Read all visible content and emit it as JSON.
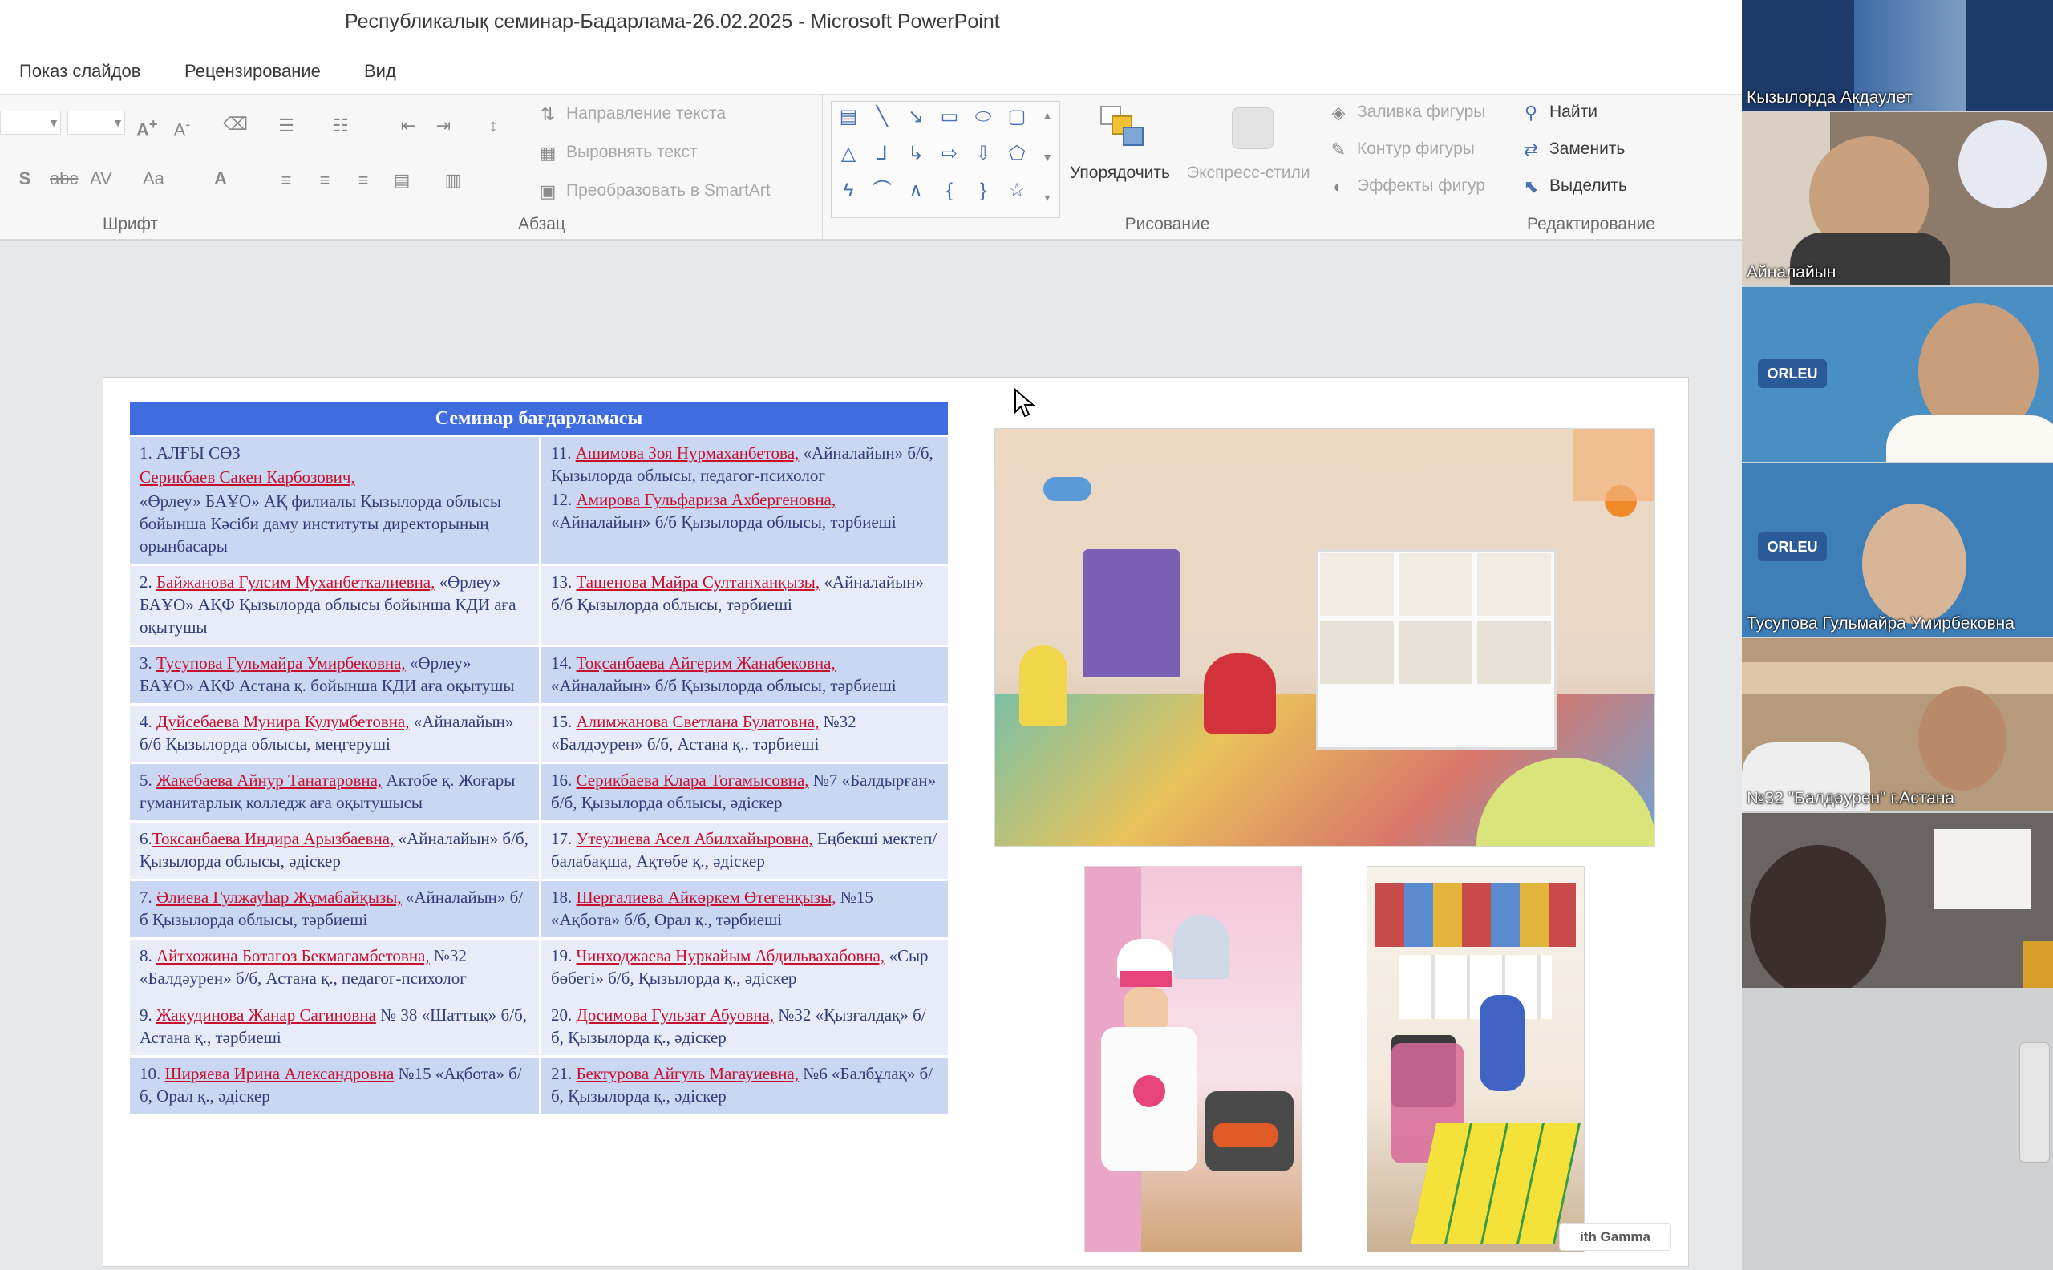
{
  "window": {
    "title": "Республикалық семинар-Бадарлама-26.02.2025  -  Microsoft PowerPoint"
  },
  "menu": [
    "Показ слайдов",
    "Рецензирование",
    "Вид"
  ],
  "ribbon": {
    "groups": {
      "font": "Шрифт",
      "paragraph": "Абзац",
      "drawing": "Рисование",
      "editing": "Редактирование"
    },
    "paragraph": {
      "text_direction": "Направление текста",
      "align_text": "Выровнять текст",
      "smartart": "Преобразовать в SmartArt"
    },
    "drawing": {
      "arrange": "Упорядочить",
      "quick_styles": "Экспресс-стили",
      "shape_fill": "Заливка фигуры",
      "shape_outline": "Контур фигуры",
      "shape_effects": "Эффекты фигур"
    },
    "editing": {
      "find": "Найти",
      "replace": "Заменить",
      "select": "Выделить"
    }
  },
  "slide": {
    "table_title": "Семинар бағдарламасы",
    "badge": "ith Gamma",
    "rows": [
      {
        "shade": "b",
        "left": [
          {
            "pre": "1.  АЛҒЫ СӨЗ",
            "name": "",
            "rest": ""
          },
          {
            "pre": "",
            "name": "Серикбаев Сакен Карбозович,",
            "rest": ""
          },
          {
            "pre": "",
            "name": "",
            "rest": "«Өрлеу» БАҰО» АҚ филиалы Қызылорда облысы бойынша Кәсіби даму институты директорының орынбасары"
          }
        ],
        "right": [
          {
            "pre": "11. ",
            "name": "Ашимова Зоя Нурмаханбетова,",
            "rest": " «Айналайын» б/б, Қызылорда облысы, педагог-психолог"
          },
          {
            "pre": "12. ",
            "name": "Амирова Гульфариза Ахбергеновна,",
            "rest": " «Айналайын» б/б Қызылорда облысы, тәрбиеші"
          }
        ]
      },
      {
        "shade": "w",
        "left": [
          {
            "pre": "2. ",
            "name": "Байжанова Гулсим Муханбеткалиевна,",
            "rest": " «Өрлеу» БАҰО» АҚФ Қызылорда облысы бойынша КДИ аға оқытушы"
          }
        ],
        "right": [
          {
            "pre": "13. ",
            "name": "Ташенова Майра       Султанханқызы,",
            "rest": " «Айналайын» б/б Қызылорда облысы, тәрбиеші"
          }
        ]
      },
      {
        "shade": "b",
        "left": [
          {
            "pre": "3. ",
            "name": "Тусупова Гульмайра Умирбековна,",
            "rest": "  «Өрлеу» БАҰО» АҚФ Астана қ. бойынша КДИ аға оқытушы"
          }
        ],
        "right": [
          {
            "pre": "14. ",
            "name": "Тоқсанбаева Айгерим Жанабековна,",
            "rest": " «Айналайын» б/б Қызылорда облысы, тәрбиеші"
          }
        ]
      },
      {
        "shade": "w",
        "left": [
          {
            "pre": "4. ",
            "name": "Дуйсебаева Мунира Кулумбетовна,",
            "rest": " «Айналайын» б/б Қызылорда облысы, меңгеруші"
          }
        ],
        "right": [
          {
            "pre": "15. ",
            "name": "Алимжанова Светлана Булатовна,",
            "rest": " №32 «Балдәурен» б/б,  Астана  қ.. тәрбиеші"
          }
        ]
      },
      {
        "shade": "b",
        "left": [
          {
            "pre": "5. ",
            "name": "Жакебаева Айнур Танатаровна,",
            "rest": " Актобе қ. Жоғары гуманитарлық колледж  аға оқытушысы"
          }
        ],
        "right": [
          {
            "pre": "16. ",
            "name": "Серикбаева Клара Тогамысовна,",
            "rest": " №7 «Балдырған» б/б, Қызылорда облысы, әдіскер"
          }
        ]
      },
      {
        "shade": "w",
        "left": [
          {
            "pre": "6.",
            "name": "Токсанбаева Индира Арызбаевна,",
            "rest": " «Айналайын» б/б,  Қызылорда облысы,  әдіскер"
          }
        ],
        "right": [
          {
            "pre": "17. ",
            "name": "Утеулиева Асел Абилхайыровна,",
            "rest": " Еңбекші мектеп/балабақша, Ақтөбе қ., әдіскер"
          }
        ]
      },
      {
        "shade": "b",
        "left": [
          {
            "pre": "7. ",
            "name": "Әлиева Гулжауһар Жұмабайқызы,",
            "rest": " «Айналайын» б/б Қызылорда облысы, тәрбиеші"
          }
        ],
        "right": [
          {
            "pre": "18. ",
            "name": "Шергалиева Айкөркем Өтегенқызы,",
            "rest": " №15 «Ақбота» б/б,  Орал қ., тәрбиеші"
          }
        ]
      },
      {
        "shade": "w",
        "left": [
          {
            "pre": "8. ",
            "name": "Айтхожина Ботагөз Бекмагамбетовна,",
            "rest": " №32 «Балдәурен» б/б,  Астана  қ., педагог-психолог"
          },
          {
            "pre": "9. ",
            "name": "Жакудинова Жанар Сагиновна",
            "rest": " № 38 «Шаттық» б/б, Астана  қ., тәрбиеші"
          }
        ],
        "right": [
          {
            "pre": "19. ",
            "name": "Чинходжаева Нуркайым Абдильвахабовна,",
            "rest": " «Сыр бөбегі» б/б, Қызылорда қ.,  әдіскер"
          },
          {
            "pre": "20. ",
            "name": "Досимова Гульзат Абуовна,",
            "rest": " №32 «Қызғалдақ» б/б, Қызылорда қ.,  әдіскер"
          }
        ]
      },
      {
        "shade": "b",
        "left": [
          {
            "pre": "10. ",
            "name": "Ширяева Ирина  Александровна",
            "rest": " №15 «Ақбота» б/б,  Орал қ., әдіскер"
          }
        ],
        "right": [
          {
            "pre": "21. ",
            "name": "Бектурова Айгуль Магауиевна,",
            "rest": " №6 «Балбұлақ» б/б, Қызылорда қ.,  әдіскер"
          }
        ]
      }
    ]
  },
  "participants": [
    {
      "name": "Кызылорда Акдаулет",
      "bg": "#1d3a6a"
    },
    {
      "name": "Айналайын",
      "bg": "#8c7a6a"
    },
    {
      "name": "",
      "bg": "#4a8fc4"
    },
    {
      "name": "Тусупова Гульмайра Умирбековна",
      "bg": "#3f7fb8"
    },
    {
      "name": "№32 \"Балдәурен\" г.Астана",
      "bg": "#b59a7c"
    },
    {
      "name": "",
      "bg": "#6a6462"
    }
  ],
  "orleu_logo": "ORLEU",
  "colors": {
    "title_bar": "#3f6de0",
    "row_dark": "#c9d7f2",
    "row_light": "#e7ecf8",
    "name_red": "#c8102e",
    "desc_blue": "#2f3d7a",
    "shape_blue": "#4a6fb0"
  }
}
